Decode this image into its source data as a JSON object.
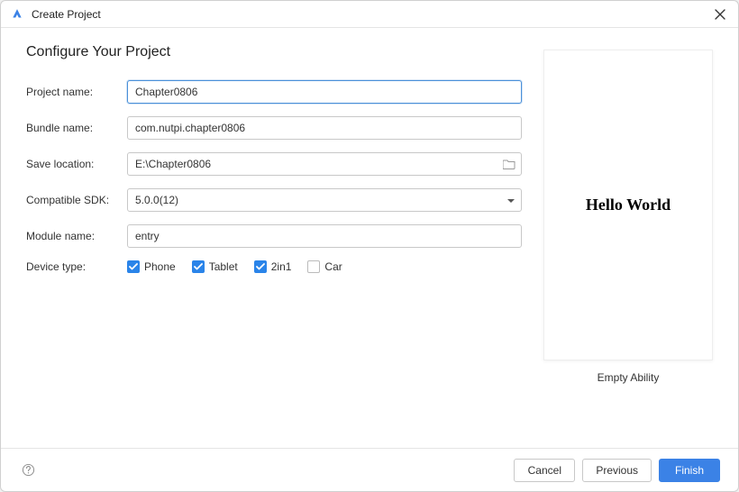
{
  "titlebar": {
    "title": "Create Project"
  },
  "heading": "Configure Your Project",
  "form": {
    "project_name": {
      "label": "Project name:",
      "value": "Chapter0806"
    },
    "bundle_name": {
      "label": "Bundle name:",
      "value": "com.nutpi.chapter0806"
    },
    "save_location": {
      "label": "Save location:",
      "value": "E:\\Chapter0806"
    },
    "compatible_sdk": {
      "label": "Compatible SDK:",
      "value": "5.0.0(12)"
    },
    "module_name": {
      "label": "Module name:",
      "value": "entry"
    },
    "device_type": {
      "label": "Device type:",
      "options": [
        {
          "label": "Phone",
          "checked": true
        },
        {
          "label": "Tablet",
          "checked": true
        },
        {
          "label": "2in1",
          "checked": true
        },
        {
          "label": "Car",
          "checked": false
        }
      ]
    }
  },
  "preview": {
    "text": "Hello World",
    "caption": "Empty Ability"
  },
  "footer": {
    "cancel": "Cancel",
    "previous": "Previous",
    "finish": "Finish"
  }
}
